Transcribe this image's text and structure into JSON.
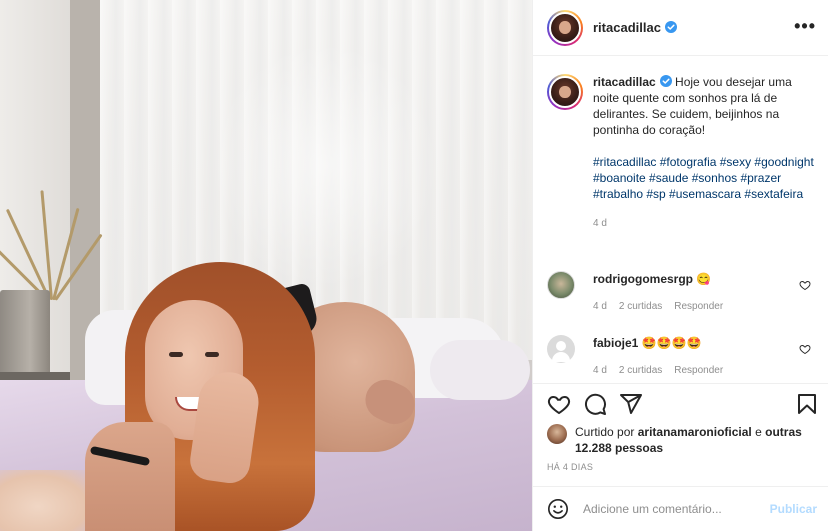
{
  "post": {
    "username": "ritacadillac",
    "verified": true,
    "more_label": "•••"
  },
  "caption": {
    "username": "ritacadillac",
    "text": "Hoje vou desejar uma noite quente com sonhos pra lá de delirantes. Se cuidem, beijinhos na pontinha do coração!",
    "hashtags": "#ritacadillac #fotografia #sexy #goodnight #boanoite #saude #sonhos #prazer #trabalho #sp #usemascara #sextafeira",
    "age": "4 d"
  },
  "comments": [
    {
      "username": "rodrigogomesrgp",
      "text": "😋",
      "age": "4 d",
      "likes": "2 curtidas",
      "reply": "Responder"
    },
    {
      "username": "fabioje1",
      "text": "🤩🤩🤩🤩",
      "age": "4 d",
      "likes": "2 curtidas",
      "reply": "Responder"
    }
  ],
  "actions": {
    "like_icon": "heart-icon",
    "comment_icon": "comment-icon",
    "share_icon": "share-icon",
    "save_icon": "bookmark-icon"
  },
  "likes": {
    "prefix": "Curtido por",
    "user": "aritanamaronioficial",
    "middle": "e",
    "others": "outras 12.288 pessoas"
  },
  "date": "HÁ 4 DIAS",
  "add_comment": {
    "placeholder": "Adicione um comentário...",
    "post_label": "Publicar"
  },
  "colors": {
    "text": "#262626",
    "muted": "#8e8e8e",
    "link": "#00376b",
    "verified": "#3897f0",
    "post_button_disabled": "#b3dbff"
  }
}
